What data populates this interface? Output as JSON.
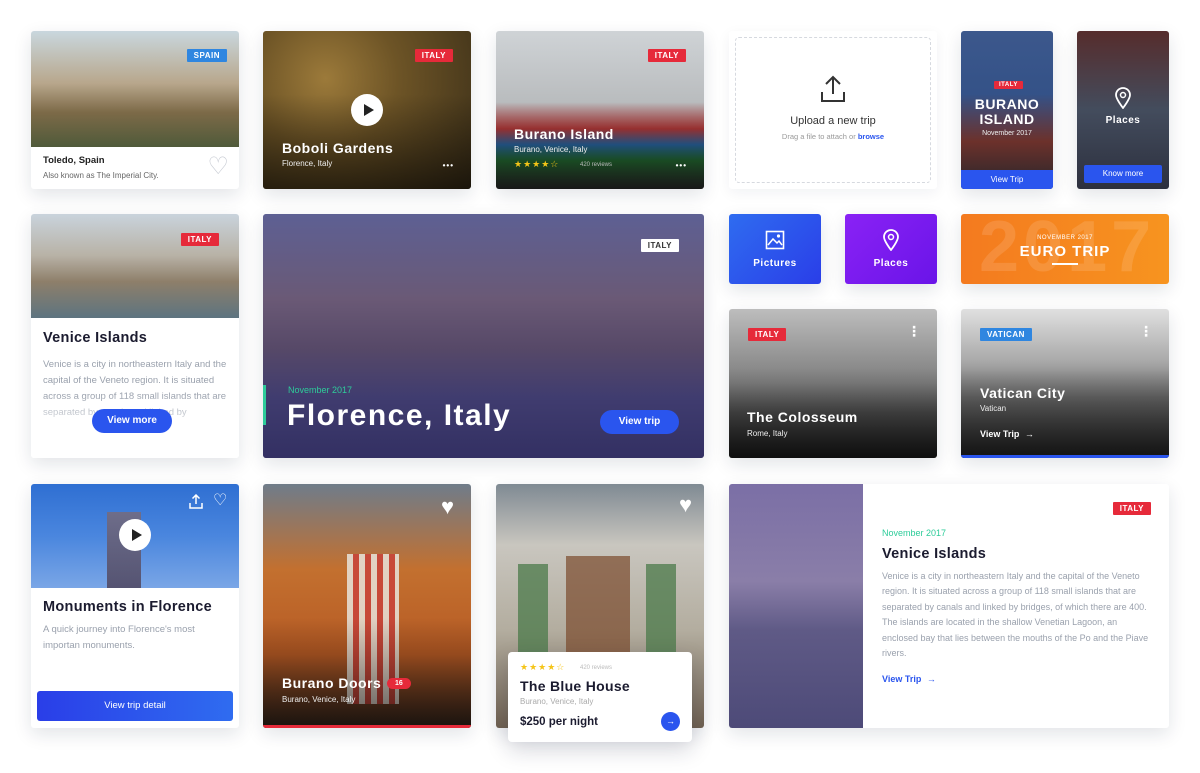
{
  "cards": {
    "toledo": {
      "tag": "SPAIN",
      "title": "Toledo, Spain",
      "subtitle": "Also known as The Imperial City.",
      "heart": "♡"
    },
    "boboli": {
      "tag": "ITALY",
      "title": "Boboli Gardens",
      "subtitle": "Florence, Italy",
      "menu": "•••"
    },
    "burano_island": {
      "tag": "ITALY",
      "title": "Burano Island",
      "subtitle": "Burano, Venice, Italy",
      "stars": "★★★★☆",
      "reviews": "420 reviews",
      "menu": "•••"
    },
    "upload": {
      "title": "Upload a new trip",
      "hint": "Drag a file to attach or",
      "link": "browse"
    },
    "burano_small": {
      "tag": "ITALY",
      "title_line1": "BURANO",
      "title_line2": "ISLAND",
      "date": "November 2017",
      "button": "View Trip"
    },
    "places_small": {
      "label": "Places",
      "button": "Know more"
    },
    "venice_left": {
      "tag": "ITALY",
      "title": "Venice Islands",
      "body": "Venice is a city in northeastern Italy and the capital of the Veneto region. It is situated across a group of 118 small islands that are separated by canals and linked by",
      "button": "View more"
    },
    "florence": {
      "tag": "ITALY",
      "date": "November 2017",
      "title": "Florence, Italy",
      "button": "View trip"
    },
    "pictures_tile": {
      "label": "Pictures"
    },
    "places_tile": {
      "label": "Places"
    },
    "euro": {
      "bg": "2017",
      "date": "NOVEMBER 2017",
      "title": "EURO TRIP"
    },
    "colosseum": {
      "tag": "ITALY",
      "title": "The Colosseum",
      "subtitle": "Rome, Italy",
      "menu": "⋮"
    },
    "vatican": {
      "tag": "VATICAN",
      "title": "Vatican City",
      "subtitle": "Vatican",
      "link": "View Trip",
      "menu": "⋮"
    },
    "monuments": {
      "title": "Monuments in Florence",
      "body": "A quick journey into Florence's most importan monuments.",
      "button": "View trip detail"
    },
    "burano_doors": {
      "title": "Burano Doors",
      "badge": "16",
      "subtitle": "Burano, Venice, Italy"
    },
    "blue_house": {
      "stars": "★★★★☆",
      "reviews": "420 reviews",
      "title": "The Blue House",
      "subtitle": "Burano, Venice, Italy",
      "price": "$250 per night"
    },
    "venice_right": {
      "tag": "ITALY",
      "date": "November 2017",
      "title": "Venice Islands",
      "body": "Venice is a city in northeastern Italy and the capital of the Veneto region. It is situated across a group of 118 small islands that are separated by canals and linked by bridges, of which there are 400. The islands are located in the shallow Venetian Lagoon, an enclosed bay that lies between the mouths of the Po and the Piave rivers.",
      "link": "View Trip"
    }
  },
  "colors": {
    "accent": "#2a55ee",
    "green": "#2ecc9a",
    "red": "#e62a3a",
    "orange": "#f47a1f",
    "purple": "#7a1df0"
  }
}
